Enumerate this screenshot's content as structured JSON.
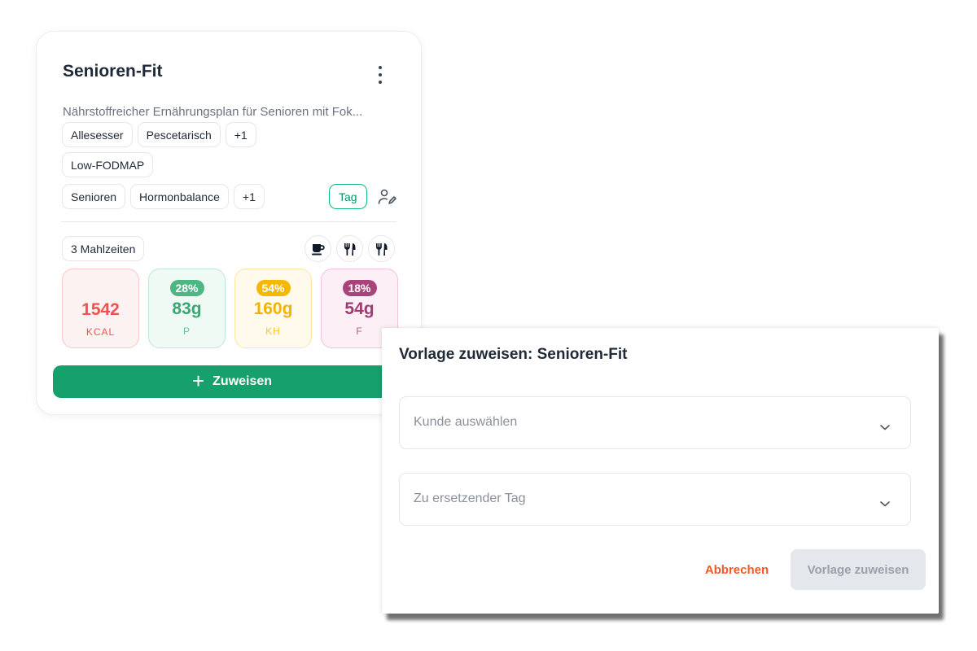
{
  "card": {
    "title": "Senioren-Fit",
    "description": "Nährstoffreicher Ernährungsplan für Senioren mit Fok...",
    "diet_tags": [
      "Allesesser",
      "Pescetarisch",
      "+1"
    ],
    "diet_tags_row2": [
      "Low-FODMAP"
    ],
    "goal_tags": [
      "Senioren",
      "Hormonbalance",
      "+1"
    ],
    "type_tag": "Tag",
    "meals_label": "3 Mahlzeiten",
    "meal_icons": [
      "coffee-cup-icon",
      "cutlery-icon",
      "cutlery-icon"
    ],
    "macros": {
      "kcal": {
        "value": "1542",
        "unit": "KCAL",
        "color": "#ef5350"
      },
      "protein": {
        "pct": "28%",
        "value": "83g",
        "unit": "P",
        "color": "#4cb783"
      },
      "carbs": {
        "pct": "54%",
        "value": "160g",
        "unit": "KH",
        "color": "#f5b800"
      },
      "fat": {
        "pct": "18%",
        "value": "54g",
        "unit": "F",
        "color": "#a8447a"
      }
    },
    "assign_label": "Zuweisen",
    "assign_icon": "plus-icon"
  },
  "dialog": {
    "title": "Vorlage zuweisen: Senioren-Fit",
    "customer_select_placeholder": "Kunde auswählen",
    "day_select_placeholder": "Zu ersetzender Tag",
    "cancel_label": "Abbrechen",
    "submit_label": "Vorlage zuweisen"
  },
  "colors": {
    "primary_green": "#16a06b",
    "cancel_orange": "#f05a28",
    "disabled_bg": "#e4e7eb"
  }
}
